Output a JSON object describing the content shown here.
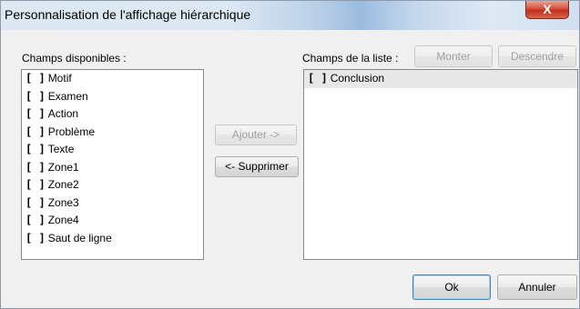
{
  "window": {
    "title": "Personnalisation de l'affichage hiérarchique",
    "close_label": "X"
  },
  "available": {
    "label": "Champs disponibles :",
    "items": [
      {
        "mark": "[ ]",
        "label": "Motif"
      },
      {
        "mark": "[ ]",
        "label": "Examen"
      },
      {
        "mark": "[ ]",
        "label": "Action"
      },
      {
        "mark": "[ ]",
        "label": "Problème"
      },
      {
        "mark": "[ ]",
        "label": "Texte"
      },
      {
        "mark": "[ ]",
        "label": "Zone1"
      },
      {
        "mark": "[ ]",
        "label": "Zone2"
      },
      {
        "mark": "[ ]",
        "label": "Zone3"
      },
      {
        "mark": "[ ]",
        "label": "Zone4"
      },
      {
        "mark": "[ ]",
        "label": "Saut de ligne"
      }
    ]
  },
  "selected": {
    "label": "Champs de la liste :",
    "items": [
      {
        "mark": "[ ]",
        "label": "Conclusion"
      }
    ]
  },
  "buttons": {
    "monter": "Monter",
    "descendre": "Descendre",
    "ajouter": "Ajouter ->",
    "supprimer": "<- Supprimer",
    "ok": "Ok",
    "annuler": "Annuler"
  }
}
